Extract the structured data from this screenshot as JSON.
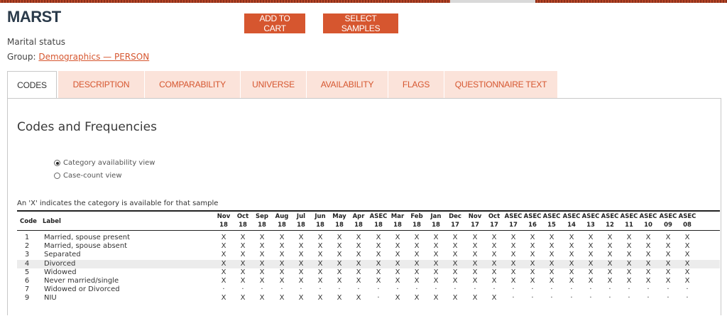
{
  "variable": {
    "name": "MARST",
    "description": "Marital status",
    "group_prefix": "Group: ",
    "group_link": "Demographics — PERSON"
  },
  "buttons": {
    "add_to_cart": "ADD TO CART",
    "select_samples": "SELECT SAMPLES"
  },
  "tabs": [
    {
      "label": "CODES",
      "active": true
    },
    {
      "label": "DESCRIPTION",
      "active": false
    },
    {
      "label": "COMPARABILITY",
      "active": false
    },
    {
      "label": "UNIVERSE",
      "active": false
    },
    {
      "label": "AVAILABILITY",
      "active": false
    },
    {
      "label": "FLAGS",
      "active": false
    },
    {
      "label": "QUESTIONNAIRE TEXT",
      "active": false
    }
  ],
  "panel": {
    "title": "Codes and Frequencies",
    "view_options": [
      {
        "label": "Category availability view",
        "selected": true
      },
      {
        "label": "Case-count view",
        "selected": false
      }
    ],
    "note": "An 'X' indicates the category is available for that sample"
  },
  "table": {
    "code_header": "Code",
    "label_header": "Label",
    "samples": [
      {
        "top": "Nov",
        "bottom": "18"
      },
      {
        "top": "Oct",
        "bottom": "18"
      },
      {
        "top": "Sep",
        "bottom": "18"
      },
      {
        "top": "Aug",
        "bottom": "18"
      },
      {
        "top": "Jul",
        "bottom": "18"
      },
      {
        "top": "Jun",
        "bottom": "18"
      },
      {
        "top": "May",
        "bottom": "18"
      },
      {
        "top": "Apr",
        "bottom": "18"
      },
      {
        "top": "ASEC",
        "bottom": "18"
      },
      {
        "top": "Mar",
        "bottom": "18"
      },
      {
        "top": "Feb",
        "bottom": "18"
      },
      {
        "top": "Jan",
        "bottom": "18"
      },
      {
        "top": "Dec",
        "bottom": "17"
      },
      {
        "top": "Nov",
        "bottom": "17"
      },
      {
        "top": "Oct",
        "bottom": "17"
      },
      {
        "top": "ASEC",
        "bottom": "17"
      },
      {
        "top": "ASEC",
        "bottom": "16"
      },
      {
        "top": "ASEC",
        "bottom": "15"
      },
      {
        "top": "ASEC",
        "bottom": "14"
      },
      {
        "top": "ASEC",
        "bottom": "13"
      },
      {
        "top": "ASEC",
        "bottom": "12"
      },
      {
        "top": "ASEC",
        "bottom": "11"
      },
      {
        "top": "ASEC",
        "bottom": "10"
      },
      {
        "top": "ASEC",
        "bottom": "09"
      },
      {
        "top": "ASEC",
        "bottom": "08"
      }
    ],
    "rows": [
      {
        "code": "1",
        "label": "Married, spouse present",
        "highlight": false,
        "cells": [
          "X",
          "X",
          "X",
          "X",
          "X",
          "X",
          "X",
          "X",
          "X",
          "X",
          "X",
          "X",
          "X",
          "X",
          "X",
          "X",
          "X",
          "X",
          "X",
          "X",
          "X",
          "X",
          "X",
          "X",
          "X"
        ]
      },
      {
        "code": "2",
        "label": "Married, spouse absent",
        "highlight": false,
        "cells": [
          "X",
          "X",
          "X",
          "X",
          "X",
          "X",
          "X",
          "X",
          "X",
          "X",
          "X",
          "X",
          "X",
          "X",
          "X",
          "X",
          "X",
          "X",
          "X",
          "X",
          "X",
          "X",
          "X",
          "X",
          "X"
        ]
      },
      {
        "code": "3",
        "label": "Separated",
        "highlight": false,
        "cells": [
          "X",
          "X",
          "X",
          "X",
          "X",
          "X",
          "X",
          "X",
          "X",
          "X",
          "X",
          "X",
          "X",
          "X",
          "X",
          "X",
          "X",
          "X",
          "X",
          "X",
          "X",
          "X",
          "X",
          "X",
          "X"
        ]
      },
      {
        "code": "4",
        "label": "Divorced",
        "highlight": true,
        "cells": [
          "X",
          "X",
          "X",
          "X",
          "X",
          "X",
          "X",
          "X",
          "X",
          "X",
          "X",
          "X",
          "X",
          "X",
          "X",
          "X",
          "X",
          "X",
          "X",
          "X",
          "X",
          "X",
          "X",
          "X",
          "X"
        ]
      },
      {
        "code": "5",
        "label": "Widowed",
        "highlight": false,
        "cells": [
          "X",
          "X",
          "X",
          "X",
          "X",
          "X",
          "X",
          "X",
          "X",
          "X",
          "X",
          "X",
          "X",
          "X",
          "X",
          "X",
          "X",
          "X",
          "X",
          "X",
          "X",
          "X",
          "X",
          "X",
          "X"
        ]
      },
      {
        "code": "6",
        "label": "Never married/single",
        "highlight": false,
        "cells": [
          "X",
          "X",
          "X",
          "X",
          "X",
          "X",
          "X",
          "X",
          "X",
          "X",
          "X",
          "X",
          "X",
          "X",
          "X",
          "X",
          "X",
          "X",
          "X",
          "X",
          "X",
          "X",
          "X",
          "X",
          "X"
        ]
      },
      {
        "code": "7",
        "label": "Widowed or Divorced",
        "highlight": false,
        "cells": [
          "·",
          "·",
          "·",
          "·",
          "·",
          "·",
          "·",
          "·",
          "·",
          "·",
          "·",
          "·",
          "·",
          "·",
          "·",
          "·",
          "·",
          "·",
          "·",
          "·",
          "·",
          "·",
          "·",
          "·",
          "·"
        ]
      },
      {
        "code": "9",
        "label": "NIU",
        "highlight": false,
        "cells": [
          "X",
          "X",
          "X",
          "X",
          "X",
          "X",
          "X",
          "X",
          "·",
          "X",
          "X",
          "X",
          "X",
          "X",
          "X",
          "·",
          "·",
          "·",
          "·",
          "·",
          "·",
          "·",
          "·",
          "·",
          "·"
        ]
      }
    ]
  },
  "colors": {
    "accent": "#d6562f",
    "tab_background": "#fbe3da",
    "row_highlight": "#ececec"
  }
}
